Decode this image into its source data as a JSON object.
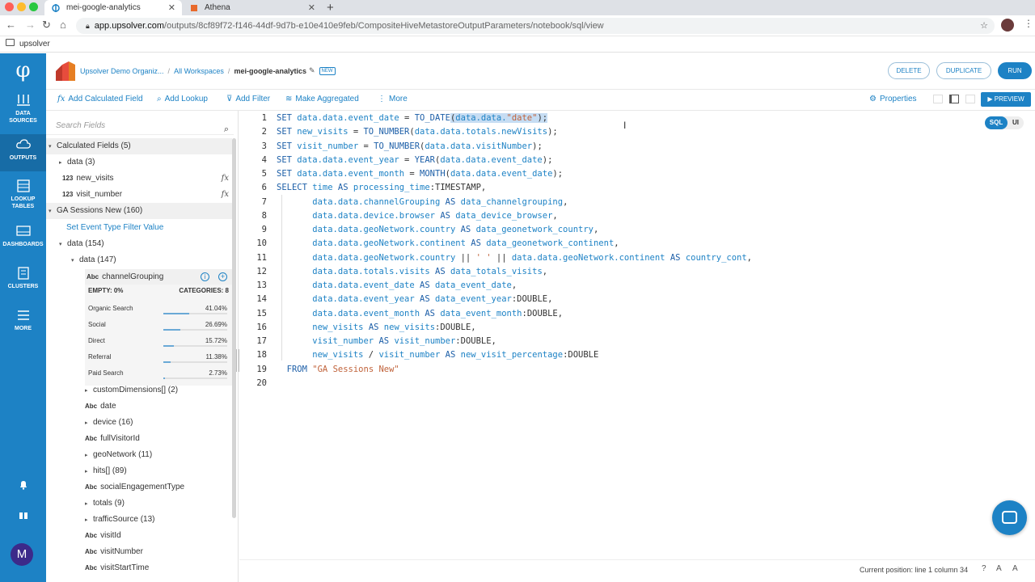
{
  "browser": {
    "tabs": [
      {
        "title": "mei-google-analytics",
        "active": true
      },
      {
        "title": "Athena",
        "active": false
      }
    ],
    "url_host": "app.upsolver.com",
    "url_path": "/outputs/8cf89f72-f146-44df-9d7b-e10e410e9feb/CompositeHiveMetastoreOutputParameters/notebook/sql/view",
    "bookmark": "upsolver"
  },
  "leftnav": {
    "items": [
      {
        "label1": "DATA",
        "label2": "SOURCES"
      },
      {
        "label1": "OUTPUTS",
        "label2": ""
      },
      {
        "label1": "LOOKUP",
        "label2": "TABLES"
      },
      {
        "label1": "DASHBOARDS",
        "label2": ""
      },
      {
        "label1": "CLUSTERS",
        "label2": ""
      },
      {
        "label1": "MORE",
        "label2": ""
      }
    ],
    "avatar_letter": "M"
  },
  "header": {
    "org": "Upsolver Demo Organiz...",
    "workspaces": "All Workspaces",
    "current": "mei-google-analytics",
    "badge": "NEW",
    "delete_label": "DELETE",
    "duplicate_label": "DUPLICATE",
    "run_label": "RUN"
  },
  "toolbar": {
    "add_calculated_field": "Add Calculated Field",
    "add_lookup": "Add Lookup",
    "add_filter": "Add Filter",
    "make_aggregated": "Make Aggregated",
    "more": "More",
    "properties": "Properties",
    "preview": "PREVIEW"
  },
  "sidebar": {
    "search_placeholder": "Search Fields",
    "calculated_fields": "Calculated Fields (5)",
    "data3": "data (3)",
    "new_visits": "new_visits",
    "visit_number": "visit_number",
    "type_num": "123",
    "type_abc": "Abc",
    "ga_sessions": "GA Sessions New (160)",
    "event_filter": "Set Event Type Filter Value",
    "data154": "data (154)",
    "data147": "data (147)",
    "channel": "channelGrouping",
    "empty": "EMPTY: 0%",
    "categories": "CATEGORIES: 8",
    "stats": [
      {
        "label": "Organic Search",
        "value": "41.04%",
        "pct": 0.41
      },
      {
        "label": "Social",
        "value": "26.69%",
        "pct": 0.27
      },
      {
        "label": "Direct",
        "value": "15.72%",
        "pct": 0.16
      },
      {
        "label": "Referral",
        "value": "11.38%",
        "pct": 0.11
      },
      {
        "label": "Paid Search",
        "value": "2.73%",
        "pct": 0.03
      }
    ],
    "fields": [
      {
        "type": "",
        "arrow": "▸",
        "label": "customDimensions[] (2)"
      },
      {
        "type": "Abc",
        "arrow": "",
        "label": "date"
      },
      {
        "type": "",
        "arrow": "▸",
        "label": "device (16)"
      },
      {
        "type": "Abc",
        "arrow": "",
        "label": "fullVisitorId"
      },
      {
        "type": "",
        "arrow": "▸",
        "label": "geoNetwork (11)"
      },
      {
        "type": "",
        "arrow": "▸",
        "label": "hits[] (89)"
      },
      {
        "type": "Abc",
        "arrow": "",
        "label": "socialEngagementType"
      },
      {
        "type": "",
        "arrow": "▸",
        "label": "totals (9)"
      },
      {
        "type": "",
        "arrow": "▸",
        "label": "trafficSource (13)"
      },
      {
        "type": "Abc",
        "arrow": "",
        "label": "visitId"
      },
      {
        "type": "Abc",
        "arrow": "",
        "label": "visitNumber"
      },
      {
        "type": "Abc",
        "arrow": "",
        "label": "visitStartTime"
      }
    ]
  },
  "editor": {
    "mode_sql": "SQL",
    "mode_ui": "UI",
    "lines": [
      "1",
      "2",
      "3",
      "4",
      "5",
      "6",
      "7",
      "8",
      "9",
      "10",
      "11",
      "12",
      "13",
      "14",
      "15",
      "16",
      "17",
      "18",
      "19",
      "20"
    ]
  },
  "status": {
    "position": "Current position: line 1 column 34"
  },
  "colors": {
    "accent": "#1d82c5",
    "nav_bg": "#1d82c5",
    "highlight": "#c6ddf3"
  }
}
